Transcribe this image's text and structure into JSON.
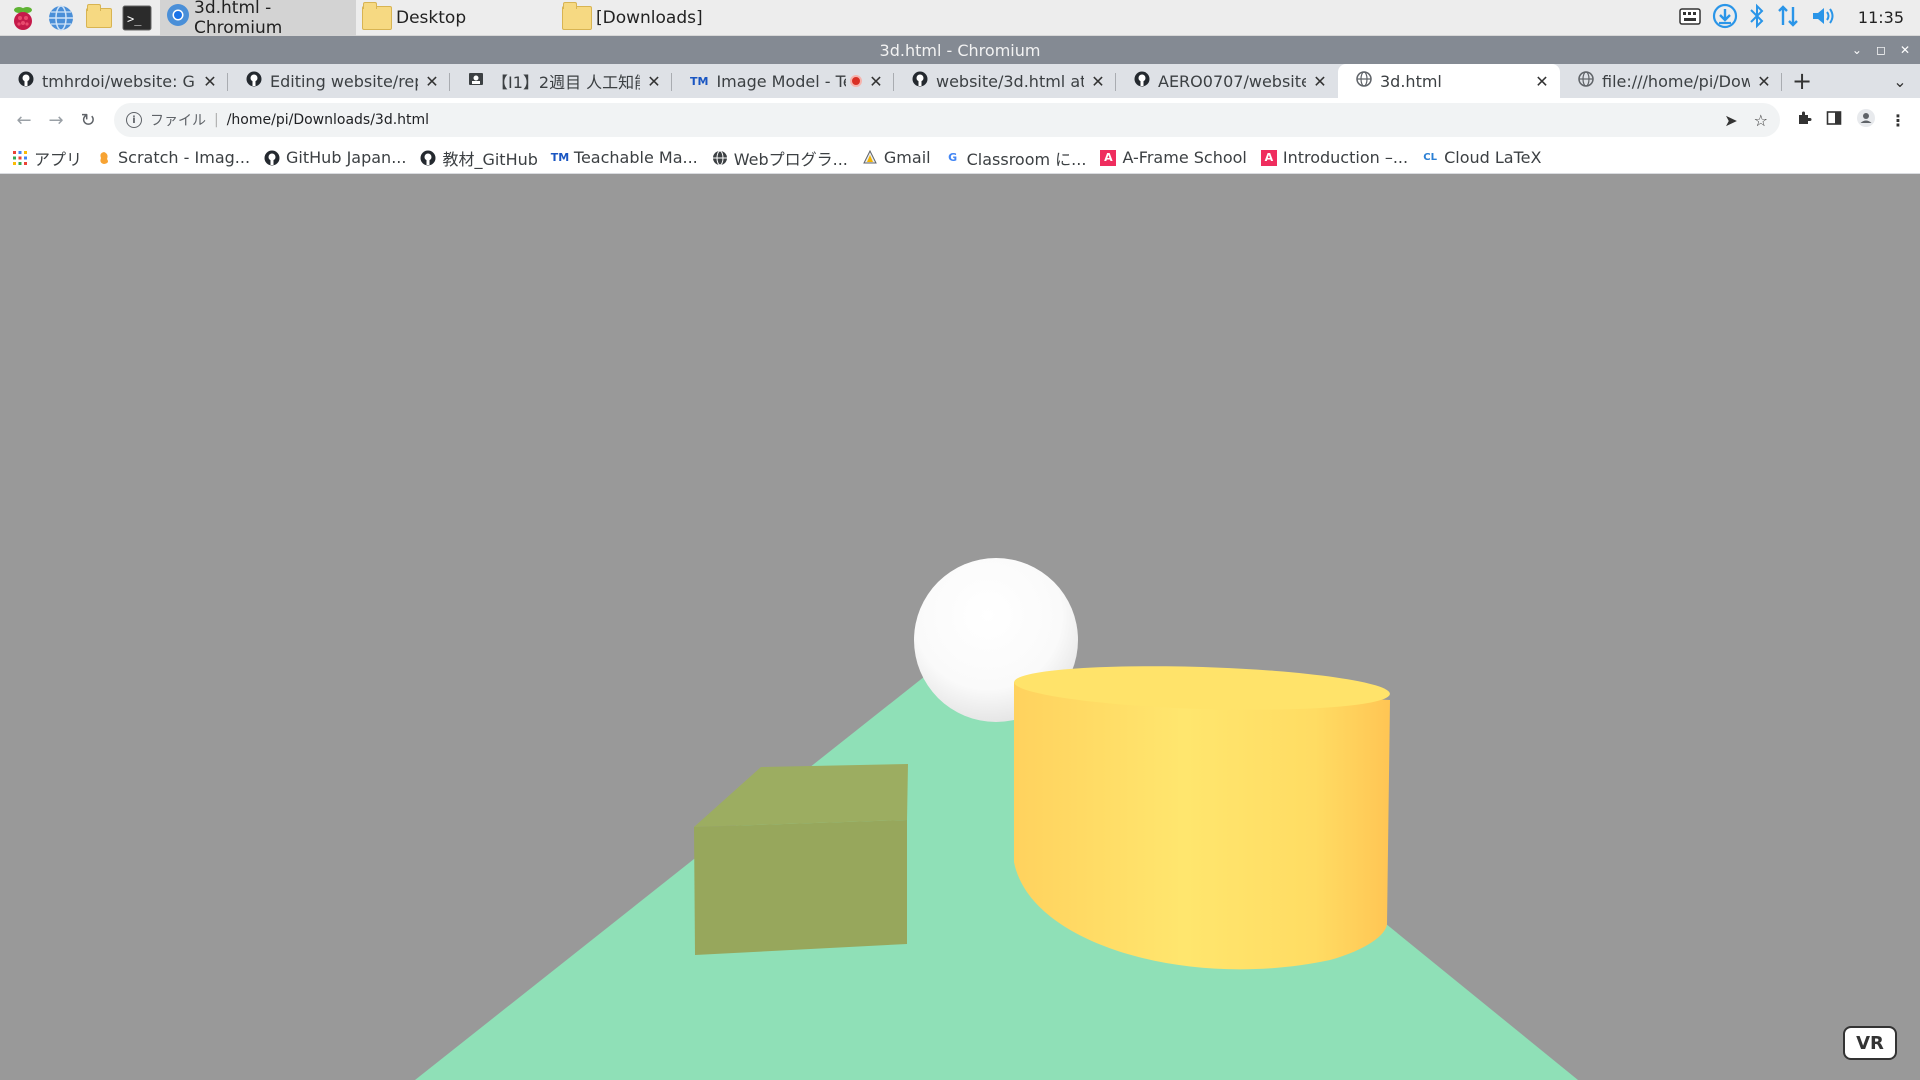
{
  "taskbar": {
    "tasks": [
      {
        "label": "3d.html - Chromium",
        "active": true
      },
      {
        "label": "Desktop",
        "active": false
      },
      {
        "label": "[Downloads]",
        "active": false
      }
    ],
    "clock": "11:35"
  },
  "window": {
    "title": "3d.html - Chromium"
  },
  "tabs": [
    {
      "title": "tmhrdoi/website: GitHub",
      "icon": "github-icon",
      "active": false
    },
    {
      "title": "Editing website/rep02",
      "icon": "github-icon",
      "active": false
    },
    {
      "title": "【I1】2週目 人工知能",
      "icon": "classroom-icon",
      "active": false
    },
    {
      "title": "Image Model - Teachable",
      "icon": "teachable-machine-icon",
      "active": false,
      "recording": true
    },
    {
      "title": "website/3d.html at main",
      "icon": "github-icon",
      "active": false
    },
    {
      "title": "AERO0707/website: GitHub",
      "icon": "github-icon",
      "active": false
    },
    {
      "title": "3d.html",
      "icon": "globe-icon",
      "active": true
    },
    {
      "title": "file:///home/pi/Downloads",
      "icon": "globe-icon",
      "active": false
    }
  ],
  "omnibox": {
    "scheme_label": "ファイル",
    "url": "/home/pi/Downloads/3d.html"
  },
  "bookmarks": [
    {
      "label": "アプリ",
      "icon": "apps-grid-icon"
    },
    {
      "label": "Scratch - Imag...",
      "icon": "scratch-icon"
    },
    {
      "label": "GitHub Japan...",
      "icon": "github-icon"
    },
    {
      "label": "教材_GitHub",
      "icon": "github-icon"
    },
    {
      "label": "Teachable Ma...",
      "icon": "teachable-machine-icon"
    },
    {
      "label": "Webプログラ...",
      "icon": "globe-icon"
    },
    {
      "label": "Gmail",
      "icon": "gmail-icon"
    },
    {
      "label": "Classroom に...",
      "icon": "google-icon"
    },
    {
      "label": "A-Frame School",
      "icon": "aframe-icon"
    },
    {
      "label": "Introduction –...",
      "icon": "aframe-icon"
    },
    {
      "label": "Cloud LaTeX",
      "icon": "cloud-latex-icon"
    }
  ],
  "scene": {
    "background_color": "#999999",
    "plane_color": "#8fe0b7",
    "sphere_color": "#ffffff",
    "box_color": "#9aa95e",
    "cylinder_color": "#ffd84f",
    "vr_button_label": "VR"
  }
}
